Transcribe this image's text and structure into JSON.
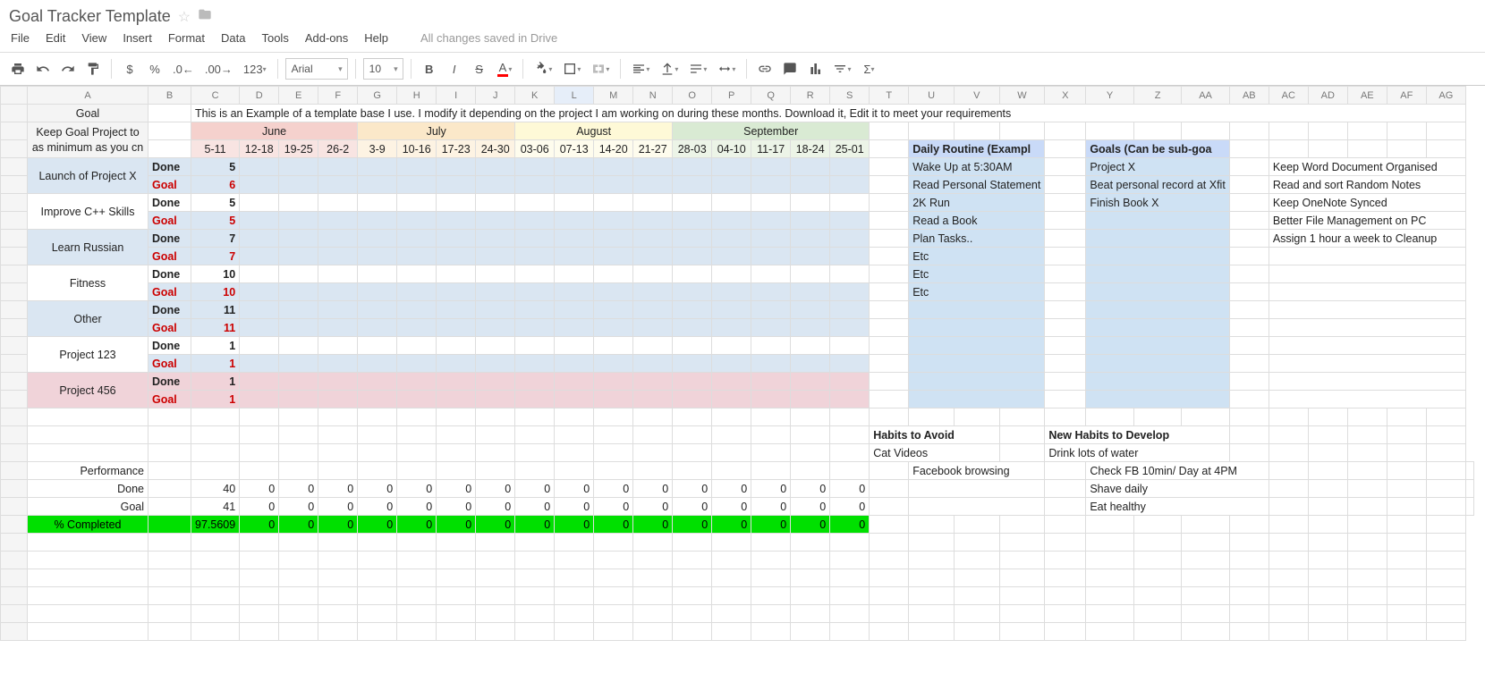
{
  "doc": {
    "title": "Goal Tracker Template",
    "save_status": "All changes saved in Drive"
  },
  "menus": [
    "File",
    "Edit",
    "View",
    "Insert",
    "Format",
    "Data",
    "Tools",
    "Add-ons",
    "Help"
  ],
  "toolbar": {
    "font": "Arial",
    "size": "10",
    "more": "123"
  },
  "cols": [
    "A",
    "B",
    "C",
    "D",
    "E",
    "F",
    "G",
    "H",
    "I",
    "J",
    "K",
    "L",
    "M",
    "N",
    "O",
    "P",
    "Q",
    "R",
    "S",
    "T",
    "U",
    "V",
    "W",
    "X",
    "Y",
    "Z",
    "AA",
    "AB",
    "AC",
    "AD",
    "AE",
    "AF",
    "AG"
  ],
  "hdr": {
    "goal": "Goal",
    "subtitle": "Keep Goal Project to as minimum as you cn",
    "desc": "This is an Example of a template base I use. I modify it depending on the project I am working on during these months. Download it, Edit it to meet your requirements"
  },
  "months": [
    "June",
    "July",
    "August",
    "September"
  ],
  "weeks": [
    "5-11",
    "12-18",
    "19-25",
    "26-2",
    "3-9",
    "10-16",
    "17-23",
    "24-30",
    "03-06",
    "07-13",
    "14-20",
    "21-27",
    "28-03",
    "04-10",
    "11-17",
    "18-24",
    "25-01"
  ],
  "goals": [
    {
      "name": "Launch of Project X",
      "done": "5",
      "goal": "6",
      "bg": "bg-blue1",
      "done_bg": "bg-blue1",
      "goal_bg": "bg-blue1"
    },
    {
      "name": "Improve C++ Skills",
      "done": "5",
      "goal": "5",
      "bg": "",
      "done_bg": "",
      "goal_bg": "bg-blue1"
    },
    {
      "name": "Learn Russian",
      "done": "7",
      "goal": "7",
      "bg": "bg-blue1",
      "done_bg": "bg-blue1",
      "goal_bg": "bg-blue1"
    },
    {
      "name": "Fitness",
      "done": "10",
      "goal": "10",
      "bg": "",
      "done_bg": "",
      "goal_bg": "bg-blue1"
    },
    {
      "name": "Other",
      "done": "11",
      "goal": "11",
      "bg": "bg-blue1",
      "done_bg": "bg-blue1",
      "goal_bg": "bg-blue1"
    },
    {
      "name": "Project 123",
      "done": "1",
      "goal": "1",
      "bg": "",
      "done_bg": "",
      "goal_bg": "bg-blue1"
    },
    {
      "name": "Project 456",
      "done": "1",
      "goal": "1",
      "bg": "bg-pink",
      "done_bg": "bg-pink",
      "goal_bg": "bg-pink"
    }
  ],
  "labels": {
    "done": "Done",
    "goal": "Goal",
    "perf": "Performance",
    "pct": "% Completed"
  },
  "perf": {
    "done": [
      "40",
      "0",
      "0",
      "0",
      "0",
      "0",
      "0",
      "0",
      "0",
      "0",
      "0",
      "0",
      "0",
      "0",
      "0",
      "0",
      "0"
    ],
    "goal": [
      "41",
      "0",
      "0",
      "0",
      "0",
      "0",
      "0",
      "0",
      "0",
      "0",
      "0",
      "0",
      "0",
      "0",
      "0",
      "0",
      "0"
    ],
    "pct": [
      "97.5609",
      "0",
      "0",
      "0",
      "0",
      "0",
      "0",
      "0",
      "0",
      "0",
      "0",
      "0",
      "0",
      "0",
      "0",
      "0",
      "0"
    ]
  },
  "side": {
    "routine_hdr": "Daily Routine (Exampl",
    "routine": [
      "Wake Up at 5:30AM",
      "Read Personal Statement",
      "2K Run",
      "Read a Book",
      "Plan Tasks..",
      "Etc",
      "Etc",
      "Etc"
    ],
    "goals_hdr": "Goals (Can be sub-goa",
    "goals": [
      "Project X",
      "Beat personal record at Xfit",
      "Finish Book X"
    ],
    "org": [
      "Keep Word Document Organised",
      "Read and sort Random Notes",
      "Keep OneNote Synced",
      "Better File Management on PC",
      "Assign 1 hour a week to Cleanup"
    ],
    "habits_avoid_hdr": "Habits to Avoid",
    "habits_avoid": [
      "Cat Videos",
      "Facebook browsing"
    ],
    "habits_new_hdr": "New Habits to Develop",
    "habits_new": [
      "Drink lots of water",
      "Check FB 10min/ Day at 4PM",
      "Shave daily",
      "Eat healthy"
    ]
  }
}
